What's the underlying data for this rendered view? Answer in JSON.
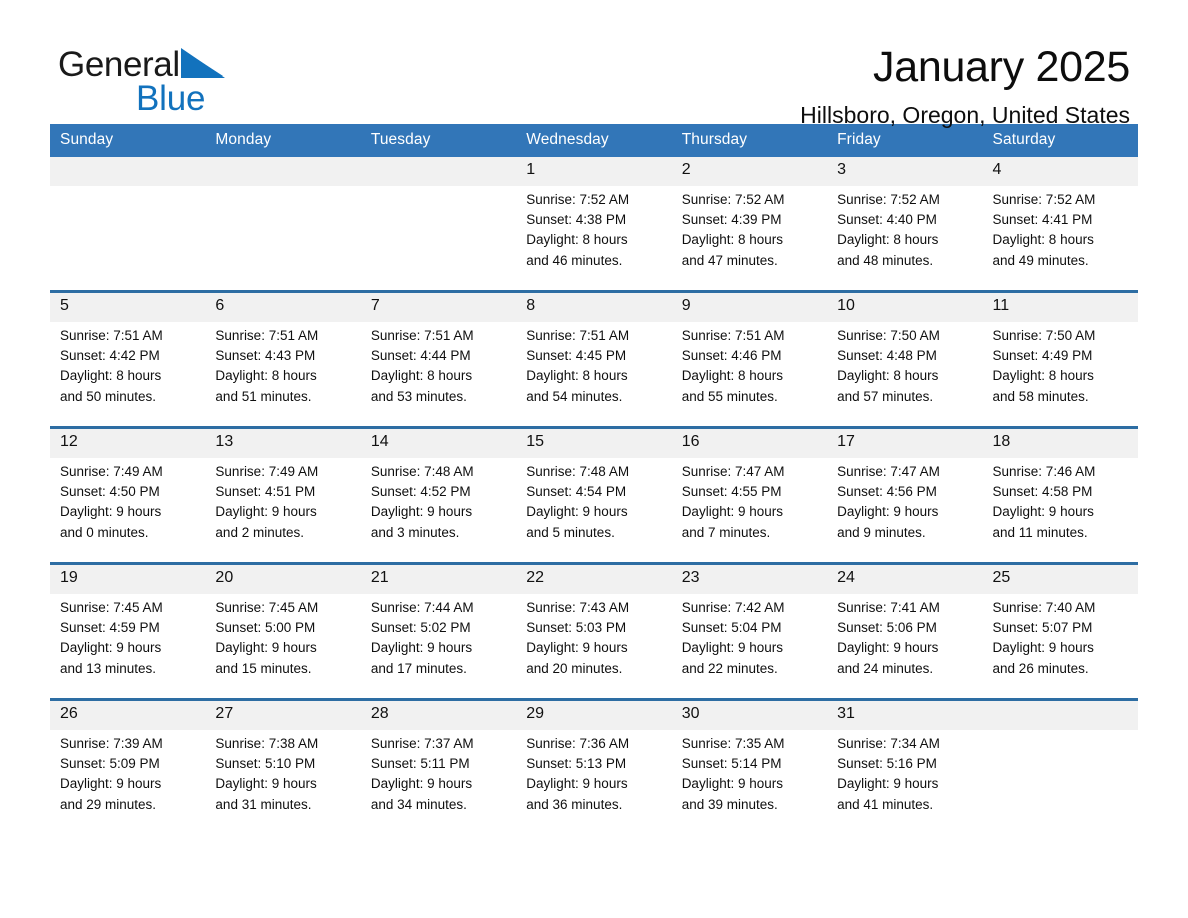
{
  "brand": {
    "name_part1": "General",
    "name_part2": "Blue",
    "triangle_color": "#1272bd"
  },
  "header": {
    "month_title": "January 2025",
    "location": "Hillsboro, Oregon, United States"
  },
  "theme": {
    "header_bg": "#3276b8",
    "week_separator": "#2d6da3",
    "daynum_bg": "#f1f1f1"
  },
  "weekday_headers": [
    "Sunday",
    "Monday",
    "Tuesday",
    "Wednesday",
    "Thursday",
    "Friday",
    "Saturday"
  ],
  "weeks": [
    {
      "days": [
        {
          "date": "",
          "sunrise": "",
          "sunset": "",
          "daylight_line1": "",
          "daylight_line2": ""
        },
        {
          "date": "",
          "sunrise": "",
          "sunset": "",
          "daylight_line1": "",
          "daylight_line2": ""
        },
        {
          "date": "",
          "sunrise": "",
          "sunset": "",
          "daylight_line1": "",
          "daylight_line2": ""
        },
        {
          "date": "1",
          "sunrise": "Sunrise: 7:52 AM",
          "sunset": "Sunset: 4:38 PM",
          "daylight_line1": "Daylight: 8 hours",
          "daylight_line2": "and 46 minutes."
        },
        {
          "date": "2",
          "sunrise": "Sunrise: 7:52 AM",
          "sunset": "Sunset: 4:39 PM",
          "daylight_line1": "Daylight: 8 hours",
          "daylight_line2": "and 47 minutes."
        },
        {
          "date": "3",
          "sunrise": "Sunrise: 7:52 AM",
          "sunset": "Sunset: 4:40 PM",
          "daylight_line1": "Daylight: 8 hours",
          "daylight_line2": "and 48 minutes."
        },
        {
          "date": "4",
          "sunrise": "Sunrise: 7:52 AM",
          "sunset": "Sunset: 4:41 PM",
          "daylight_line1": "Daylight: 8 hours",
          "daylight_line2": "and 49 minutes."
        }
      ]
    },
    {
      "days": [
        {
          "date": "5",
          "sunrise": "Sunrise: 7:51 AM",
          "sunset": "Sunset: 4:42 PM",
          "daylight_line1": "Daylight: 8 hours",
          "daylight_line2": "and 50 minutes."
        },
        {
          "date": "6",
          "sunrise": "Sunrise: 7:51 AM",
          "sunset": "Sunset: 4:43 PM",
          "daylight_line1": "Daylight: 8 hours",
          "daylight_line2": "and 51 minutes."
        },
        {
          "date": "7",
          "sunrise": "Sunrise: 7:51 AM",
          "sunset": "Sunset: 4:44 PM",
          "daylight_line1": "Daylight: 8 hours",
          "daylight_line2": "and 53 minutes."
        },
        {
          "date": "8",
          "sunrise": "Sunrise: 7:51 AM",
          "sunset": "Sunset: 4:45 PM",
          "daylight_line1": "Daylight: 8 hours",
          "daylight_line2": "and 54 minutes."
        },
        {
          "date": "9",
          "sunrise": "Sunrise: 7:51 AM",
          "sunset": "Sunset: 4:46 PM",
          "daylight_line1": "Daylight: 8 hours",
          "daylight_line2": "and 55 minutes."
        },
        {
          "date": "10",
          "sunrise": "Sunrise: 7:50 AM",
          "sunset": "Sunset: 4:48 PM",
          "daylight_line1": "Daylight: 8 hours",
          "daylight_line2": "and 57 minutes."
        },
        {
          "date": "11",
          "sunrise": "Sunrise: 7:50 AM",
          "sunset": "Sunset: 4:49 PM",
          "daylight_line1": "Daylight: 8 hours",
          "daylight_line2": "and 58 minutes."
        }
      ]
    },
    {
      "days": [
        {
          "date": "12",
          "sunrise": "Sunrise: 7:49 AM",
          "sunset": "Sunset: 4:50 PM",
          "daylight_line1": "Daylight: 9 hours",
          "daylight_line2": "and 0 minutes."
        },
        {
          "date": "13",
          "sunrise": "Sunrise: 7:49 AM",
          "sunset": "Sunset: 4:51 PM",
          "daylight_line1": "Daylight: 9 hours",
          "daylight_line2": "and 2 minutes."
        },
        {
          "date": "14",
          "sunrise": "Sunrise: 7:48 AM",
          "sunset": "Sunset: 4:52 PM",
          "daylight_line1": "Daylight: 9 hours",
          "daylight_line2": "and 3 minutes."
        },
        {
          "date": "15",
          "sunrise": "Sunrise: 7:48 AM",
          "sunset": "Sunset: 4:54 PM",
          "daylight_line1": "Daylight: 9 hours",
          "daylight_line2": "and 5 minutes."
        },
        {
          "date": "16",
          "sunrise": "Sunrise: 7:47 AM",
          "sunset": "Sunset: 4:55 PM",
          "daylight_line1": "Daylight: 9 hours",
          "daylight_line2": "and 7 minutes."
        },
        {
          "date": "17",
          "sunrise": "Sunrise: 7:47 AM",
          "sunset": "Sunset: 4:56 PM",
          "daylight_line1": "Daylight: 9 hours",
          "daylight_line2": "and 9 minutes."
        },
        {
          "date": "18",
          "sunrise": "Sunrise: 7:46 AM",
          "sunset": "Sunset: 4:58 PM",
          "daylight_line1": "Daylight: 9 hours",
          "daylight_line2": "and 11 minutes."
        }
      ]
    },
    {
      "days": [
        {
          "date": "19",
          "sunrise": "Sunrise: 7:45 AM",
          "sunset": "Sunset: 4:59 PM",
          "daylight_line1": "Daylight: 9 hours",
          "daylight_line2": "and 13 minutes."
        },
        {
          "date": "20",
          "sunrise": "Sunrise: 7:45 AM",
          "sunset": "Sunset: 5:00 PM",
          "daylight_line1": "Daylight: 9 hours",
          "daylight_line2": "and 15 minutes."
        },
        {
          "date": "21",
          "sunrise": "Sunrise: 7:44 AM",
          "sunset": "Sunset: 5:02 PM",
          "daylight_line1": "Daylight: 9 hours",
          "daylight_line2": "and 17 minutes."
        },
        {
          "date": "22",
          "sunrise": "Sunrise: 7:43 AM",
          "sunset": "Sunset: 5:03 PM",
          "daylight_line1": "Daylight: 9 hours",
          "daylight_line2": "and 20 minutes."
        },
        {
          "date": "23",
          "sunrise": "Sunrise: 7:42 AM",
          "sunset": "Sunset: 5:04 PM",
          "daylight_line1": "Daylight: 9 hours",
          "daylight_line2": "and 22 minutes."
        },
        {
          "date": "24",
          "sunrise": "Sunrise: 7:41 AM",
          "sunset": "Sunset: 5:06 PM",
          "daylight_line1": "Daylight: 9 hours",
          "daylight_line2": "and 24 minutes."
        },
        {
          "date": "25",
          "sunrise": "Sunrise: 7:40 AM",
          "sunset": "Sunset: 5:07 PM",
          "daylight_line1": "Daylight: 9 hours",
          "daylight_line2": "and 26 minutes."
        }
      ]
    },
    {
      "days": [
        {
          "date": "26",
          "sunrise": "Sunrise: 7:39 AM",
          "sunset": "Sunset: 5:09 PM",
          "daylight_line1": "Daylight: 9 hours",
          "daylight_line2": "and 29 minutes."
        },
        {
          "date": "27",
          "sunrise": "Sunrise: 7:38 AM",
          "sunset": "Sunset: 5:10 PM",
          "daylight_line1": "Daylight: 9 hours",
          "daylight_line2": "and 31 minutes."
        },
        {
          "date": "28",
          "sunrise": "Sunrise: 7:37 AM",
          "sunset": "Sunset: 5:11 PM",
          "daylight_line1": "Daylight: 9 hours",
          "daylight_line2": "and 34 minutes."
        },
        {
          "date": "29",
          "sunrise": "Sunrise: 7:36 AM",
          "sunset": "Sunset: 5:13 PM",
          "daylight_line1": "Daylight: 9 hours",
          "daylight_line2": "and 36 minutes."
        },
        {
          "date": "30",
          "sunrise": "Sunrise: 7:35 AM",
          "sunset": "Sunset: 5:14 PM",
          "daylight_line1": "Daylight: 9 hours",
          "daylight_line2": "and 39 minutes."
        },
        {
          "date": "31",
          "sunrise": "Sunrise: 7:34 AM",
          "sunset": "Sunset: 5:16 PM",
          "daylight_line1": "Daylight: 9 hours",
          "daylight_line2": "and 41 minutes."
        },
        {
          "date": "",
          "sunrise": "",
          "sunset": "",
          "daylight_line1": "",
          "daylight_line2": ""
        }
      ]
    }
  ]
}
